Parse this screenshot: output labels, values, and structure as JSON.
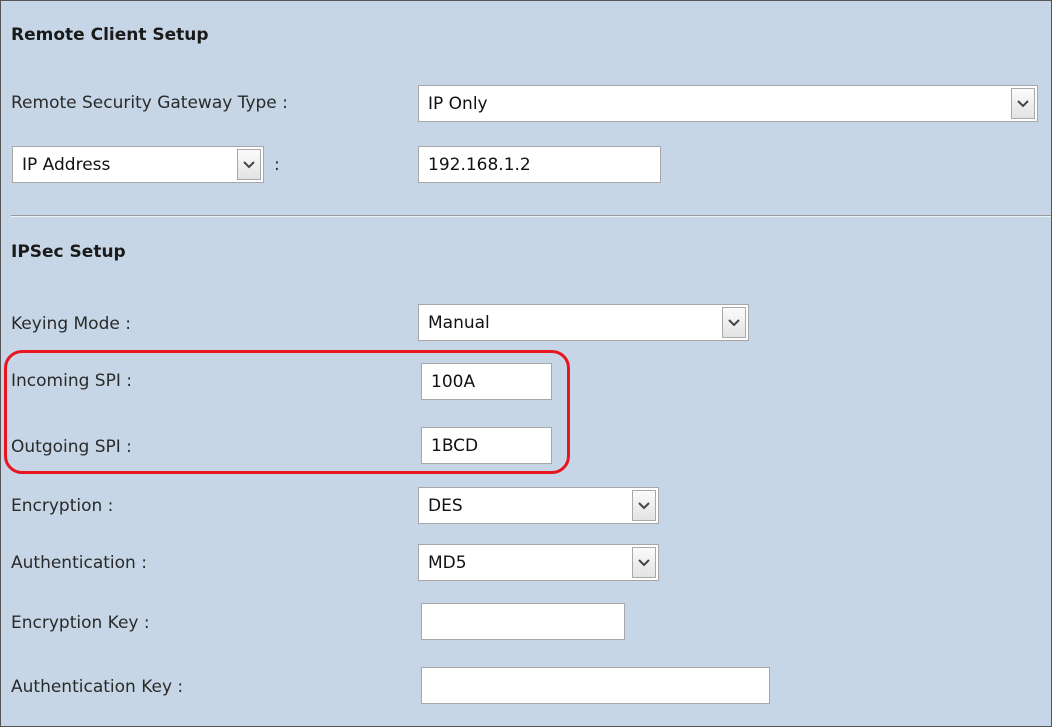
{
  "remote_client": {
    "section_title": "Remote Client Setup",
    "gateway_type": {
      "label": "Remote Security Gateway Type :",
      "value": "IP Only"
    },
    "id_type": {
      "selected": "IP Address",
      "separator": ":",
      "value": "192.168.1.2"
    }
  },
  "ipsec": {
    "section_title": "IPSec Setup",
    "keying_mode": {
      "label": "Keying Mode :",
      "value": "Manual"
    },
    "incoming_spi": {
      "label": "Incoming SPI :",
      "value": "100A"
    },
    "outgoing_spi": {
      "label": "Outgoing SPI :",
      "value": "1BCD"
    },
    "encryption": {
      "label": "Encryption :",
      "value": "DES"
    },
    "authentication": {
      "label": "Authentication :",
      "value": "MD5"
    },
    "encryption_key": {
      "label": "Encryption Key :",
      "value": ""
    },
    "authentication_key": {
      "label": "Authentication Key :",
      "value": ""
    }
  },
  "icons": {
    "dropdown": "chevron-down-icon"
  },
  "colors": {
    "panel_background": "#c6d6e6",
    "highlight": "#e8141f"
  }
}
